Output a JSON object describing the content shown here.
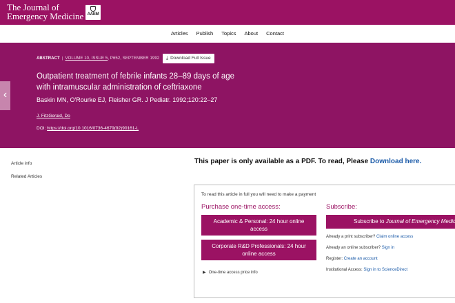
{
  "header": {
    "journal_title_line1": "The Journal of",
    "journal_title_line2": "Emergency Medicine",
    "logo_text": "AAEM"
  },
  "nav": {
    "items": [
      "Articles",
      "Publish",
      "Topics",
      "About",
      "Contact"
    ]
  },
  "hero": {
    "label": "ABSTRACT",
    "volume_info": "VOLUME 10, ISSUE 5",
    "pages_date": ", P652, SEPTEMBER 1992",
    "download_issue": "Download Full Issue",
    "title": "Outpatient treatment of febrile infants 28–89 days of age with intramuscular administration of ceftriaxone",
    "citation": "Baskin MN, O'Rourke EJ, Fleisher GR. J Pediatr. 1992;120:22–27",
    "author": "J. FitzGerald, Do",
    "doi_label": "DOI: ",
    "doi_link": "https://doi.org/10.1016/0736-4679(92)90161-L"
  },
  "sidebar": {
    "article_info": "Article info",
    "related_articles": "Related Articles"
  },
  "notice": {
    "text": "This paper is only available as a PDF. To read, Please ",
    "link": "Download here."
  },
  "purchase": {
    "intro": "To read this article in full you will need to make a payment",
    "one_time_heading": "Purchase one-time access:",
    "academic_button": "Academic & Personal: 24 hour online access",
    "corporate_button": "Corporate R&D Professionals: 24 hour online access",
    "price_info": "One-time access price info",
    "subscribe_heading": "Subscribe:",
    "subscribe_button_prefix": "Subscribe to ",
    "subscribe_button_journal": "Journal of Emergency Medicine",
    "print_subscriber": "Already a print subscriber? ",
    "claim_link": "Claim online access",
    "online_subscriber": "Already an online subscriber? ",
    "sign_in_link": "Sign in",
    "register": "Register: ",
    "create_account_link": "Create an account",
    "institutional": "Institutional Access: ",
    "sciencedirect_link": "Sign in to ScienceDirect"
  },
  "colors": {
    "brand": "#9b1263",
    "hero": "#8e1463",
    "link": "#1a5aa8"
  }
}
